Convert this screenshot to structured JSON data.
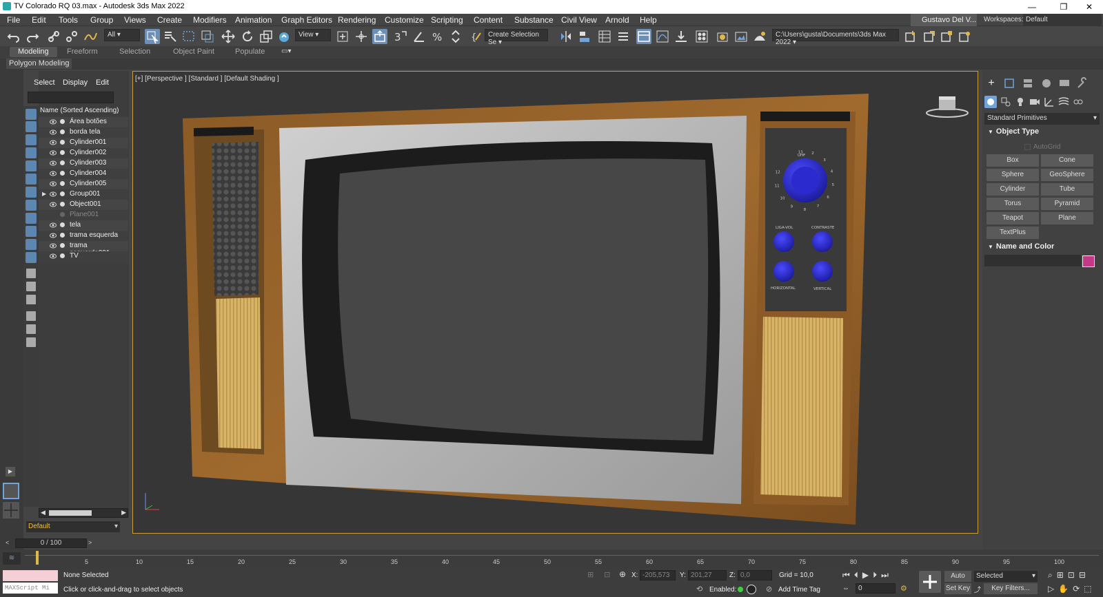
{
  "window": {
    "title": "TV Colorado RQ 03.max - Autodesk 3ds Max 2022",
    "minimize": "—",
    "restore": "❐",
    "close": "✕"
  },
  "menu": [
    "File",
    "Edit",
    "Tools",
    "Group",
    "Views",
    "Create",
    "Modifiers",
    "Animation",
    "Graph Editors",
    "Rendering",
    "Customize",
    "Scripting",
    "Content",
    "Substance",
    "Civil View",
    "Arnold",
    "Help"
  ],
  "user": {
    "name": "Gustavo Del V...",
    "workspaces_label": "Workspaces:",
    "workspace": "Default"
  },
  "toolbar": {
    "filter": "All",
    "ref_coord": "View",
    "selection_set": "Create Selection Se",
    "project_path": "C:\\Users\\gusta\\Documents\\3ds Max 2022"
  },
  "ribbon": {
    "tabs": [
      "Modeling",
      "Freeform",
      "Selection",
      "Object Paint",
      "Populate"
    ],
    "active": "Modeling",
    "panel": "Polygon Modeling"
  },
  "explorer": {
    "tabs": [
      "Select",
      "Display",
      "Edit"
    ],
    "header": "Name (Sorted Ascending)",
    "items": [
      "Área botões",
      "borda tela",
      "Cylinder001",
      "Cylinder002",
      "Cylinder003",
      "Cylinder004",
      "Cylinder005",
      "Group001",
      "Object001",
      "Plane001",
      "tela",
      "trama esquerda",
      "trama esquerda001",
      "TV"
    ],
    "hidden_item": "Plane001",
    "group_item": "Group001",
    "layer": "Default"
  },
  "viewport": {
    "label": "[+] [Perspective ] [Standard ] [Default Shading ]",
    "panel_labels": {
      "uhf": "UHF",
      "liga_vol": "LIGA-VOL",
      "contraste": "CONTRASTE",
      "horizontal": "HORIZONTAL",
      "vertical": "VERTICAL"
    },
    "dial_numbers": [
      "13",
      "2",
      "3",
      "4",
      "5",
      "6",
      "7",
      "8",
      "9",
      "10",
      "11",
      "12"
    ]
  },
  "command_panel": {
    "category": "Standard Primitives",
    "object_type_title": "Object Type",
    "autogrid": "AutoGrid",
    "primitives": [
      "Box",
      "Cone",
      "Sphere",
      "GeoSphere",
      "Cylinder",
      "Tube",
      "Torus",
      "Pyramid",
      "Teapot",
      "Plane",
      "TextPlus"
    ],
    "name_color_title": "Name and Color",
    "object_color": "#c23a86"
  },
  "timeline": {
    "frame_display": "0 / 100",
    "ticks": [
      "5",
      "10",
      "15",
      "20",
      "25",
      "30",
      "35",
      "40",
      "45",
      "50",
      "55",
      "60",
      "65",
      "70",
      "75",
      "80",
      "85",
      "90",
      "95",
      "100"
    ]
  },
  "status": {
    "maxscript": "MAXScript Mi",
    "selection": "None Selected",
    "prompt": "Click or click-and-drag to select objects",
    "x_label": "X:",
    "x_value": "-205,573",
    "y_label": "Y:",
    "y_value": "201,27",
    "z_label": "Z:",
    "z_value": "0,0",
    "grid": "Grid = 10,0",
    "enabled": "Enabled:",
    "add_time_tag": "Add Time Tag",
    "auto_key": "Auto Key",
    "set_key": "Set Key",
    "key_mode": "Selected",
    "key_filters": "Key Filters...",
    "frame": "0"
  }
}
